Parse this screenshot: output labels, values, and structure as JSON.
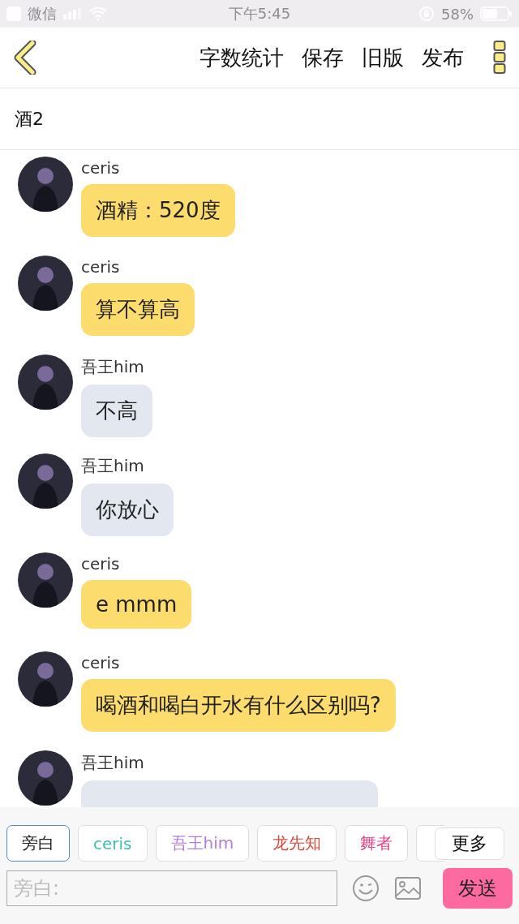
{
  "status_bar": {
    "back_app": "微信",
    "time": "下午5:45",
    "battery": "58%"
  },
  "toolbar": {
    "actions": [
      "字数统计",
      "保存",
      "旧版",
      "发布"
    ]
  },
  "title": "酒2",
  "messages": [
    {
      "sender": "ceris",
      "text": "酒精：520度",
      "color": "#fddc6e"
    },
    {
      "sender": "ceris",
      "text": "算不算高",
      "color": "#fddc6e"
    },
    {
      "sender": "吾王him",
      "text": "不高",
      "color": "#e3e8f0"
    },
    {
      "sender": "吾王him",
      "text": "你放心",
      "color": "#e3e8f0"
    },
    {
      "sender": "ceris",
      "text": "e mmm",
      "color": "#fddc6e"
    },
    {
      "sender": "ceris",
      "text": "喝酒和喝白开水有什么区别吗?",
      "color": "#fddc6e"
    },
    {
      "sender": "吾王him",
      "color": "#e3e8f0"
    }
  ],
  "speakers": [
    {
      "label": "旁白",
      "color": "#222222",
      "selected": true
    },
    {
      "label": "ceris",
      "color": "#3dbfae",
      "selected": false
    },
    {
      "label": "吾王him",
      "color": "#b07ed8",
      "selected": false
    },
    {
      "label": "龙先知",
      "color": "#d9483b",
      "selected": false
    },
    {
      "label": "舞者",
      "color": "#e0468a",
      "selected": false
    },
    {
      "selected": false
    }
  ],
  "more_button": "更多",
  "input": {
    "placeholder": "旁白:"
  },
  "send_button": "发送"
}
